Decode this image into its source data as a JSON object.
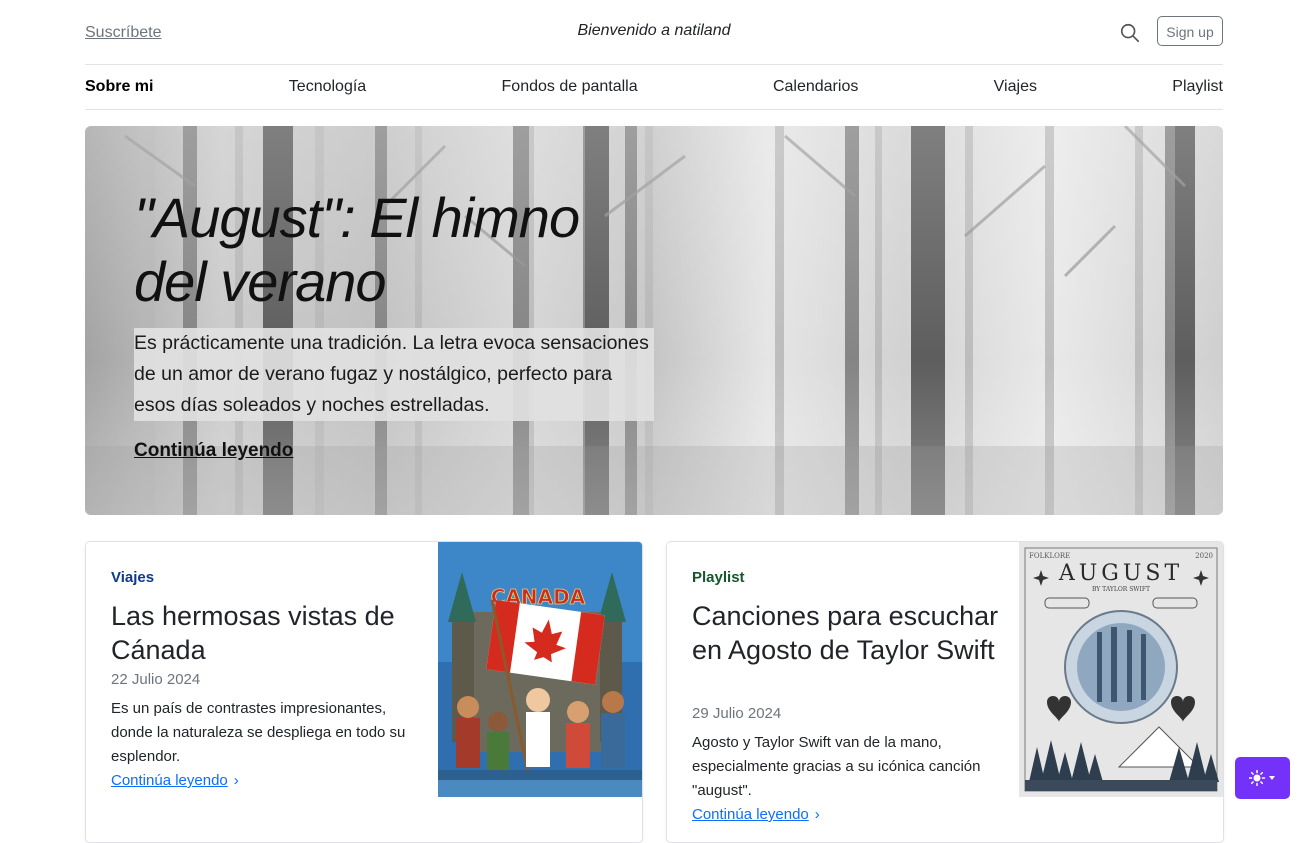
{
  "header": {
    "subscribe": "Suscríbete",
    "site_title": "Bienvenido a natiland",
    "signup": "Sign up",
    "search_icon": "search-icon"
  },
  "nav": {
    "items": [
      {
        "label": "Sobre mi",
        "active": true
      },
      {
        "label": "Tecnología"
      },
      {
        "label": "Fondos de pantalla"
      },
      {
        "label": "Calendarios"
      },
      {
        "label": "Viajes"
      },
      {
        "label": "Playlist"
      }
    ]
  },
  "hero": {
    "title": "\"August\": El himno del verano",
    "lead": "Es prácticamente una tradición. La letra evoca sensaciones de un amor de verano fugaz y nostálgico, perfecto para esos días soleados y noches estrelladas.",
    "link": "Continúa leyendo"
  },
  "cards": [
    {
      "category": "Viajes",
      "title": "Las hermosas vistas de Cánada",
      "date": "22 Julio 2024",
      "text": "Es un país de contrastes impresionantes, donde la naturaleza se despliega en todo su esplendor.",
      "link": "Continúa leyendo",
      "image_banner": "CANADA"
    },
    {
      "category": "Playlist",
      "title": "Canciones para escuchar en Agosto de Taylor Swift",
      "date": "29 Julio 2024",
      "text": "Agosto y Taylor Swift van de la mano, especialmente gracias a su icónica canción \"august\".",
      "link": "Continúa leyendo",
      "image_top_left": "FOLKLORE",
      "image_top_right": "2020",
      "image_title": "AUGUST",
      "image_subtitle": "BY TAYLOR SWIFT"
    }
  ],
  "theme_toggle": {
    "icon": "sun-icon",
    "color": "#7431f9"
  }
}
